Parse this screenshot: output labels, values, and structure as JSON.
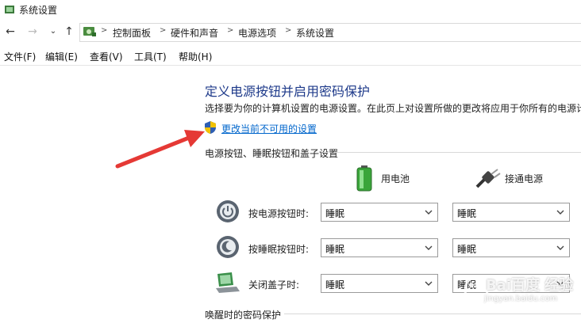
{
  "window": {
    "title": "系统设置"
  },
  "nav": {
    "back_icon": "arrow-left-icon",
    "forward_icon": "arrow-right-icon",
    "recent_icon": "chevron-down-icon",
    "up_icon": "arrow-up-icon"
  },
  "breadcrumb": [
    "控制面板",
    "硬件和声音",
    "电源选项",
    "系统设置"
  ],
  "menu": [
    "文件(F)",
    "编辑(E)",
    "查看(V)",
    "工具(T)",
    "帮助(H)"
  ],
  "main": {
    "title": "定义电源按钮并启用密码保护",
    "description": "选择要为你的计算机设置的电源设置。在此页上对设置所做的更改将应用于你所有的电源计",
    "change_link": "更改当前不可用的设置",
    "section_buttons": "电源按钮、睡眠按钮和盖子设置",
    "col_battery": "用电池",
    "col_plugged": "接通电源",
    "rows": [
      {
        "label": "按电源按钮时:",
        "battery": "睡眠",
        "plugged": "睡眠"
      },
      {
        "label": "按睡眠按钮时:",
        "battery": "睡眠",
        "plugged": "睡眠"
      },
      {
        "label": "关闭盖子时:",
        "battery": "睡眠",
        "plugged": "睡眠"
      }
    ],
    "section_wake": "唤醒时的密码保护"
  },
  "watermark": {
    "text": "Bai百度 经验",
    "sub": "jingyan.baidu.com"
  },
  "colors": {
    "accent_title": "#1e3a8a",
    "link": "#0066cc",
    "arrow": "#e53935"
  }
}
